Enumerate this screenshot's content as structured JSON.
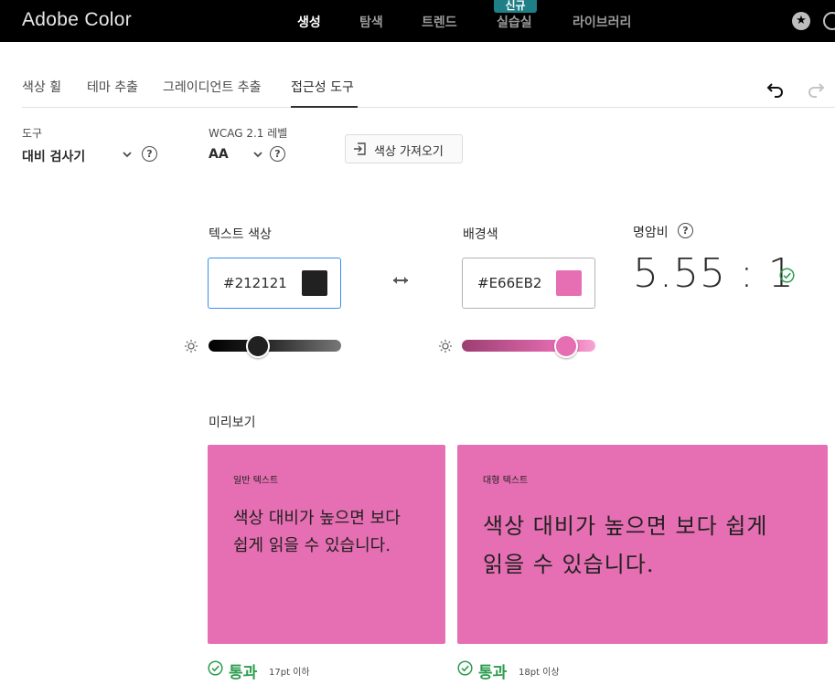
{
  "app": {
    "brand": "Adobe Color"
  },
  "topnav": {
    "items": [
      "생성",
      "탐색",
      "트렌드",
      "실습실",
      "라이브러리"
    ],
    "active": "생성",
    "badge": "신규"
  },
  "tabs": {
    "items": [
      "색상 휠",
      "테마 추출",
      "그레이디언트 추출",
      "접근성 도구"
    ],
    "active": "접근성 도구"
  },
  "controls": {
    "tool_label": "도구",
    "tool_value": "대비 검사기",
    "wcag_label": "WCAG 2.1 레벨",
    "wcag_value": "AA",
    "import_label": "색상 가져오기"
  },
  "text_color": {
    "label": "텍스트 색상",
    "hex": "#212121",
    "swatch": "#212121",
    "slider_level": 0.37
  },
  "bg_color": {
    "label": "배경색",
    "hex": "#E66EB2",
    "swatch": "#E66EB2",
    "slider_level": 0.78
  },
  "contrast": {
    "label": "명암비",
    "value": "5.55 : 1"
  },
  "preview": {
    "label": "미리보기",
    "normal": {
      "caption": "일반 텍스트",
      "sample": "색상 대비가 높으면 보다 쉽게 읽을 수 있습니다.",
      "status": "통과",
      "note": "17pt 이하"
    },
    "large": {
      "caption": "대형 텍스트",
      "sample": "색상 대비가 높으면 보다 쉽게 읽을 수 있습니다.",
      "status": "통과",
      "note": "18pt 이상"
    }
  },
  "colors": {
    "pass_green": "#2d9d4f",
    "focus_blue": "#378ef0",
    "badge_teal": "#1f7f86"
  },
  "icons": [
    "star-icon",
    "moon-icon",
    "undo-icon",
    "redo-icon",
    "chevron-down-icon",
    "help-icon",
    "import-icon",
    "swap-icon",
    "sun-icon",
    "check-circle-icon"
  ]
}
